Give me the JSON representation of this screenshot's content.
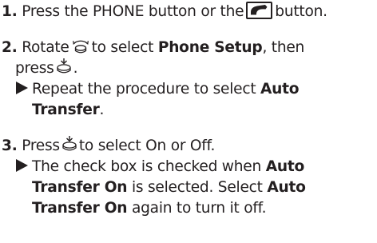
{
  "steps": [
    {
      "number": "1.",
      "text_before": "Press the PHONE button or the",
      "text_after": "button.",
      "icon": "phone-button-icon"
    },
    {
      "number": "2.",
      "line1_a": "Rotate",
      "line1_b": "to select",
      "line1_bold": "Phone Setup",
      "line1_c": ", then",
      "line2_a": "press",
      "line2_b": ".",
      "sub_line1_a": "Repeat the procedure to select",
      "sub_line1_bold": "Auto",
      "sub_line2_bold": "Transfer",
      "sub_line2_c": ".",
      "icons": [
        "selector-knob-icon",
        "enter-button-icon",
        "arrow-right-icon"
      ]
    },
    {
      "number": "3.",
      "line1_a": "Press",
      "line1_b": "to select On or Off.",
      "sub_line1_a": "The check box is checked when",
      "sub_line1_bold": "Auto",
      "sub_line2_bold1": "Transfer On",
      "sub_line2_b": "is selected. Select",
      "sub_line2_bold2": "Auto",
      "sub_line3_bold": "Transfer On",
      "sub_line3_c": "again to turn it off.",
      "icons": [
        "enter-button-icon",
        "arrow-right-icon"
      ]
    }
  ],
  "colors": {
    "text": "#231f20",
    "background": "#ffffff"
  }
}
